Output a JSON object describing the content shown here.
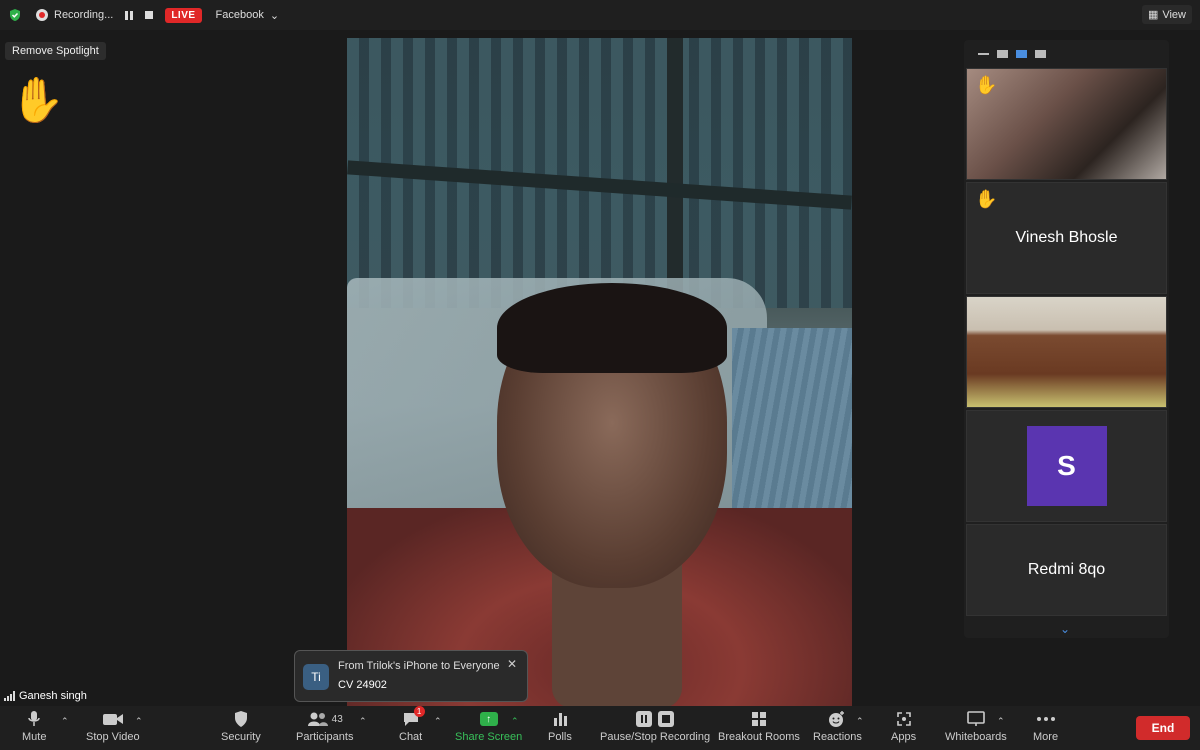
{
  "topbar": {
    "recording_label": "Recording...",
    "live_label": "LIVE",
    "stream_target": "Facebook",
    "view_label": "View"
  },
  "main": {
    "remove_spotlight_label": "Remove Spotlight",
    "speaker_name": "Ganesh singh"
  },
  "gallery": {
    "tiles": [
      {
        "name": "",
        "hand_raised": true
      },
      {
        "name": "Vinesh Bhosle",
        "hand_raised": true
      },
      {
        "name": "",
        "hand_raised": false
      },
      {
        "name": "",
        "avatar_letter": "S",
        "hand_raised": false
      },
      {
        "name": "Redmi 8qo",
        "hand_raised": false
      }
    ]
  },
  "chat_popup": {
    "avatar_initials": "Ti",
    "from_label": "From Trilok's iPhone to Everyone",
    "message": "CV 24902"
  },
  "toolbar": {
    "mute": "Mute",
    "stop_video": "Stop Video",
    "security": "Security",
    "participants": "Participants",
    "participants_count": "43",
    "chat": "Chat",
    "chat_badge": "1",
    "share_screen": "Share Screen",
    "polls": "Polls",
    "pause_stop_recording": "Pause/Stop Recording",
    "breakout_rooms": "Breakout Rooms",
    "reactions": "Reactions",
    "apps": "Apps",
    "whiteboards": "Whiteboards",
    "more": "More",
    "end": "End"
  },
  "colors": {
    "live_red": "#e02828",
    "share_green": "#2fb04a",
    "end_red": "#d12b2b",
    "accent_blue": "#4a8ee0",
    "avatar_purple": "#5a35b0"
  }
}
